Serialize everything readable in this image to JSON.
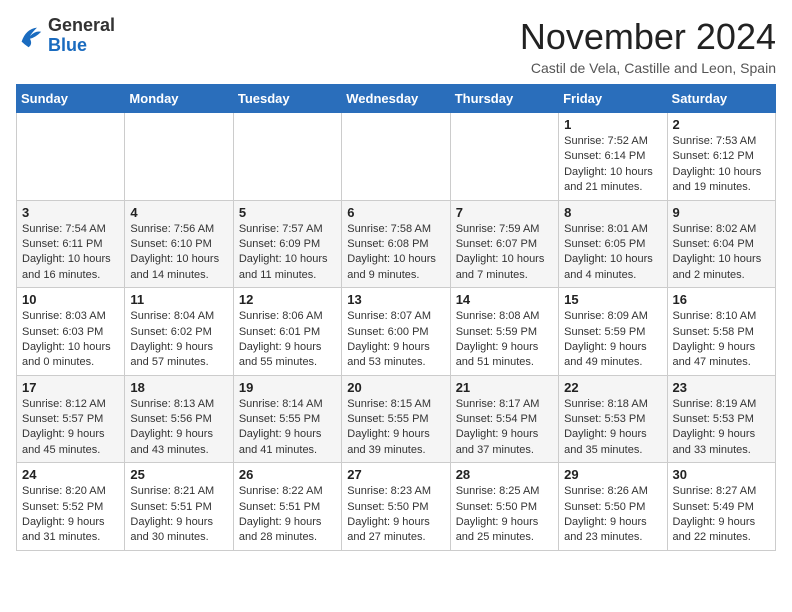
{
  "logo": {
    "general": "General",
    "blue": "Blue"
  },
  "header": {
    "month": "November 2024",
    "location": "Castil de Vela, Castille and Leon, Spain"
  },
  "weekdays": [
    "Sunday",
    "Monday",
    "Tuesday",
    "Wednesday",
    "Thursday",
    "Friday",
    "Saturday"
  ],
  "weeks": [
    [
      {
        "day": "",
        "info": ""
      },
      {
        "day": "",
        "info": ""
      },
      {
        "day": "",
        "info": ""
      },
      {
        "day": "",
        "info": ""
      },
      {
        "day": "",
        "info": ""
      },
      {
        "day": "1",
        "info": "Sunrise: 7:52 AM\nSunset: 6:14 PM\nDaylight: 10 hours and 21 minutes."
      },
      {
        "day": "2",
        "info": "Sunrise: 7:53 AM\nSunset: 6:12 PM\nDaylight: 10 hours and 19 minutes."
      }
    ],
    [
      {
        "day": "3",
        "info": "Sunrise: 7:54 AM\nSunset: 6:11 PM\nDaylight: 10 hours and 16 minutes."
      },
      {
        "day": "4",
        "info": "Sunrise: 7:56 AM\nSunset: 6:10 PM\nDaylight: 10 hours and 14 minutes."
      },
      {
        "day": "5",
        "info": "Sunrise: 7:57 AM\nSunset: 6:09 PM\nDaylight: 10 hours and 11 minutes."
      },
      {
        "day": "6",
        "info": "Sunrise: 7:58 AM\nSunset: 6:08 PM\nDaylight: 10 hours and 9 minutes."
      },
      {
        "day": "7",
        "info": "Sunrise: 7:59 AM\nSunset: 6:07 PM\nDaylight: 10 hours and 7 minutes."
      },
      {
        "day": "8",
        "info": "Sunrise: 8:01 AM\nSunset: 6:05 PM\nDaylight: 10 hours and 4 minutes."
      },
      {
        "day": "9",
        "info": "Sunrise: 8:02 AM\nSunset: 6:04 PM\nDaylight: 10 hours and 2 minutes."
      }
    ],
    [
      {
        "day": "10",
        "info": "Sunrise: 8:03 AM\nSunset: 6:03 PM\nDaylight: 10 hours and 0 minutes."
      },
      {
        "day": "11",
        "info": "Sunrise: 8:04 AM\nSunset: 6:02 PM\nDaylight: 9 hours and 57 minutes."
      },
      {
        "day": "12",
        "info": "Sunrise: 8:06 AM\nSunset: 6:01 PM\nDaylight: 9 hours and 55 minutes."
      },
      {
        "day": "13",
        "info": "Sunrise: 8:07 AM\nSunset: 6:00 PM\nDaylight: 9 hours and 53 minutes."
      },
      {
        "day": "14",
        "info": "Sunrise: 8:08 AM\nSunset: 5:59 PM\nDaylight: 9 hours and 51 minutes."
      },
      {
        "day": "15",
        "info": "Sunrise: 8:09 AM\nSunset: 5:59 PM\nDaylight: 9 hours and 49 minutes."
      },
      {
        "day": "16",
        "info": "Sunrise: 8:10 AM\nSunset: 5:58 PM\nDaylight: 9 hours and 47 minutes."
      }
    ],
    [
      {
        "day": "17",
        "info": "Sunrise: 8:12 AM\nSunset: 5:57 PM\nDaylight: 9 hours and 45 minutes."
      },
      {
        "day": "18",
        "info": "Sunrise: 8:13 AM\nSunset: 5:56 PM\nDaylight: 9 hours and 43 minutes."
      },
      {
        "day": "19",
        "info": "Sunrise: 8:14 AM\nSunset: 5:55 PM\nDaylight: 9 hours and 41 minutes."
      },
      {
        "day": "20",
        "info": "Sunrise: 8:15 AM\nSunset: 5:55 PM\nDaylight: 9 hours and 39 minutes."
      },
      {
        "day": "21",
        "info": "Sunrise: 8:17 AM\nSunset: 5:54 PM\nDaylight: 9 hours and 37 minutes."
      },
      {
        "day": "22",
        "info": "Sunrise: 8:18 AM\nSunset: 5:53 PM\nDaylight: 9 hours and 35 minutes."
      },
      {
        "day": "23",
        "info": "Sunrise: 8:19 AM\nSunset: 5:53 PM\nDaylight: 9 hours and 33 minutes."
      }
    ],
    [
      {
        "day": "24",
        "info": "Sunrise: 8:20 AM\nSunset: 5:52 PM\nDaylight: 9 hours and 31 minutes."
      },
      {
        "day": "25",
        "info": "Sunrise: 8:21 AM\nSunset: 5:51 PM\nDaylight: 9 hours and 30 minutes."
      },
      {
        "day": "26",
        "info": "Sunrise: 8:22 AM\nSunset: 5:51 PM\nDaylight: 9 hours and 28 minutes."
      },
      {
        "day": "27",
        "info": "Sunrise: 8:23 AM\nSunset: 5:50 PM\nDaylight: 9 hours and 27 minutes."
      },
      {
        "day": "28",
        "info": "Sunrise: 8:25 AM\nSunset: 5:50 PM\nDaylight: 9 hours and 25 minutes."
      },
      {
        "day": "29",
        "info": "Sunrise: 8:26 AM\nSunset: 5:50 PM\nDaylight: 9 hours and 23 minutes."
      },
      {
        "day": "30",
        "info": "Sunrise: 8:27 AM\nSunset: 5:49 PM\nDaylight: 9 hours and 22 minutes."
      }
    ]
  ]
}
